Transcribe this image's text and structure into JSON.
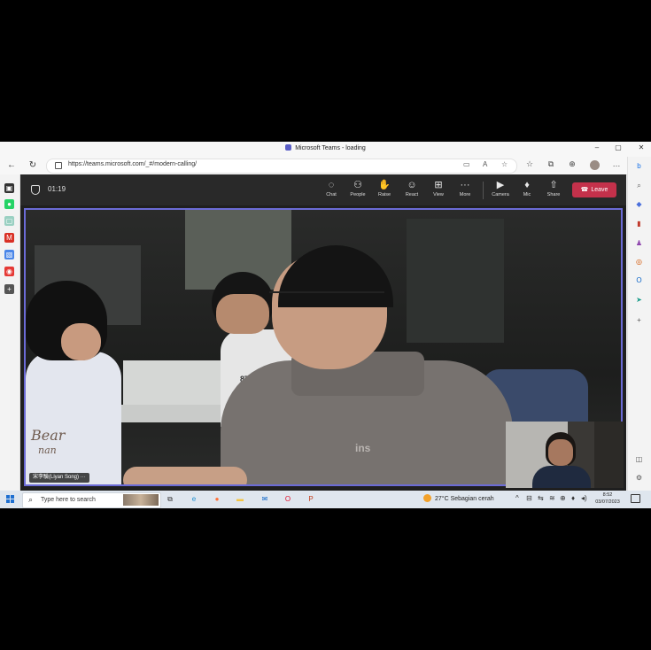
{
  "window": {
    "title": "Microsoft Teams - loading",
    "minimize": "–",
    "restore": "▢",
    "close": "✕"
  },
  "browser": {
    "back": "←",
    "refresh": "↻",
    "url": "https://teams.microsoft.com/_#/modern-calling/",
    "url_icons": [
      "▭",
      "A",
      "☆"
    ],
    "right_icons": [
      "☆",
      "⧉",
      "⊕",
      "…"
    ]
  },
  "left_sidebar": {
    "items": [
      {
        "name": "tabs-icon",
        "glyph": "▣",
        "color": "#333333"
      },
      {
        "name": "whatsapp-icon",
        "glyph": "●",
        "color": "#25d366"
      },
      {
        "name": "app-icon",
        "glyph": "▢",
        "color": "#9ad0c2"
      },
      {
        "name": "gmail-icon",
        "glyph": "M",
        "color": "#d93025"
      },
      {
        "name": "translate-icon",
        "glyph": "▧",
        "color": "#4a86e8"
      },
      {
        "name": "record-icon",
        "glyph": "◉",
        "color": "#e53935"
      },
      {
        "name": "add-icon",
        "glyph": "+",
        "color": "#555555"
      }
    ]
  },
  "right_sidebar": {
    "items": [
      {
        "name": "bing-icon",
        "glyph": "b",
        "color": "#1a73e8"
      },
      {
        "name": "search-icon",
        "glyph": "⌕",
        "color": "#555555"
      },
      {
        "name": "tag-icon",
        "glyph": "◆",
        "color": "#4a6fdc"
      },
      {
        "name": "briefcase-icon",
        "glyph": "▮",
        "color": "#c0392b"
      },
      {
        "name": "games-icon",
        "glyph": "♟",
        "color": "#8e44ad"
      },
      {
        "name": "office-icon",
        "glyph": "◎",
        "color": "#d35400"
      },
      {
        "name": "outlook-icon",
        "glyph": "O",
        "color": "#0a64c8"
      },
      {
        "name": "send-icon",
        "glyph": "➤",
        "color": "#1a9c8a"
      },
      {
        "name": "add-icon",
        "glyph": "+",
        "color": "#555555"
      },
      {
        "name": "split-screen-icon",
        "glyph": "◫",
        "color": "#555555"
      },
      {
        "name": "settings-icon",
        "glyph": "⚙",
        "color": "#555555"
      }
    ]
  },
  "teams": {
    "timer": "01:19",
    "controls": [
      {
        "key": "chat",
        "label": "Chat",
        "glyph": "◌"
      },
      {
        "key": "people",
        "label": "People",
        "glyph": "⚇"
      },
      {
        "key": "raise",
        "label": "Raise",
        "glyph": "✋"
      },
      {
        "key": "react",
        "label": "React",
        "glyph": "☺"
      },
      {
        "key": "view",
        "label": "View",
        "glyph": "⊞"
      },
      {
        "key": "more",
        "label": "More",
        "glyph": "···"
      },
      {
        "key": "camera",
        "label": "Camera",
        "glyph": "▶"
      },
      {
        "key": "mic",
        "label": "Mic",
        "glyph": "♦"
      },
      {
        "key": "share",
        "label": "Share",
        "glyph": "⇧"
      }
    ],
    "leave_label": "Leave",
    "leave_color": "#c4314b",
    "participant_name": "宋李驗(Liyan Song)",
    "participant_more": "···",
    "video_shirt_text_1": "Bear",
    "video_shirt_text_2": "nan",
    "video_shirt_text_3": "8TT",
    "video_logo_text": "ins"
  },
  "taskbar": {
    "search_placeholder": "Type here to search",
    "apps": [
      {
        "name": "task-view-icon",
        "glyph": "⧉",
        "color": "#333333"
      },
      {
        "name": "edge-icon",
        "glyph": "e",
        "color": "#1e8fd0"
      },
      {
        "name": "firefox-icon",
        "glyph": "●",
        "color": "#ff7139"
      },
      {
        "name": "file-explorer-icon",
        "glyph": "▬",
        "color": "#f4c542"
      },
      {
        "name": "mail-icon",
        "glyph": "✉",
        "color": "#0a64c8"
      },
      {
        "name": "opera-icon",
        "glyph": "O",
        "color": "#e0102b"
      },
      {
        "name": "powerpoint-icon",
        "glyph": "P",
        "color": "#c43e1c"
      }
    ],
    "weather": "27°C  Sebagian cerah",
    "tray_icons": [
      "^",
      "⊟",
      "⇆",
      "≋",
      "⊕",
      "♦",
      "◂)"
    ],
    "time": "8:52",
    "date": "03/07/2023"
  }
}
